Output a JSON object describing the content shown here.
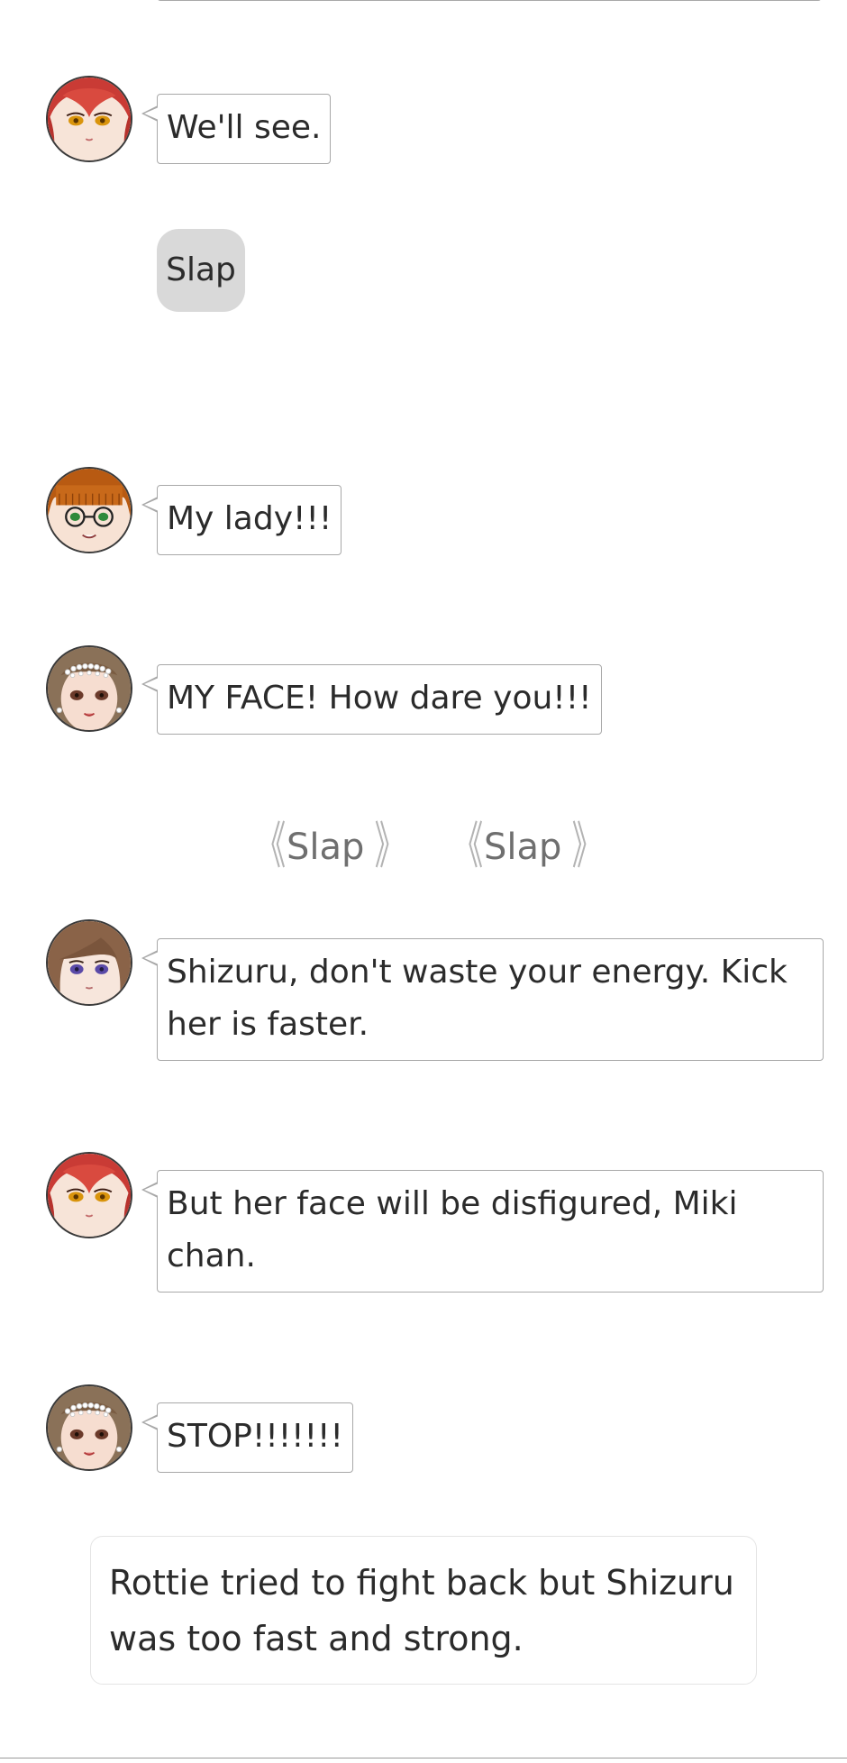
{
  "messages": [
    {
      "character": "red-hair-girl",
      "text": "We'll see."
    },
    {
      "character": "glasses-girl",
      "text": "My lady!!!"
    },
    {
      "character": "pearl-tiara-girl",
      "text": "MY FACE! How dare you!!!"
    },
    {
      "character": "brown-hair-girl",
      "text": "Shizuru, don't waste your energy. Kick her is faster."
    },
    {
      "character": "red-hair-girl",
      "text": "But her face will be disfigured, Miki chan."
    },
    {
      "character": "pearl-tiara-girl",
      "text": "STOP!!!!!!!"
    }
  ],
  "action": {
    "label": "Slap"
  },
  "sound_effects": [
    {
      "left_bracket": "《",
      "text": "Slap",
      "right_bracket": "》"
    },
    {
      "left_bracket": "《",
      "text": "Slap",
      "right_bracket": "》"
    }
  ],
  "narration": {
    "text": "Rottie tried to fight back but Shizuru was too fast and strong."
  },
  "colors": {
    "bubble_border": "#a8a8a8",
    "pill_bg": "#d9d9d9",
    "sfx_text": "#6f6f6f",
    "sfx_bracket": "#b3b3b3"
  }
}
